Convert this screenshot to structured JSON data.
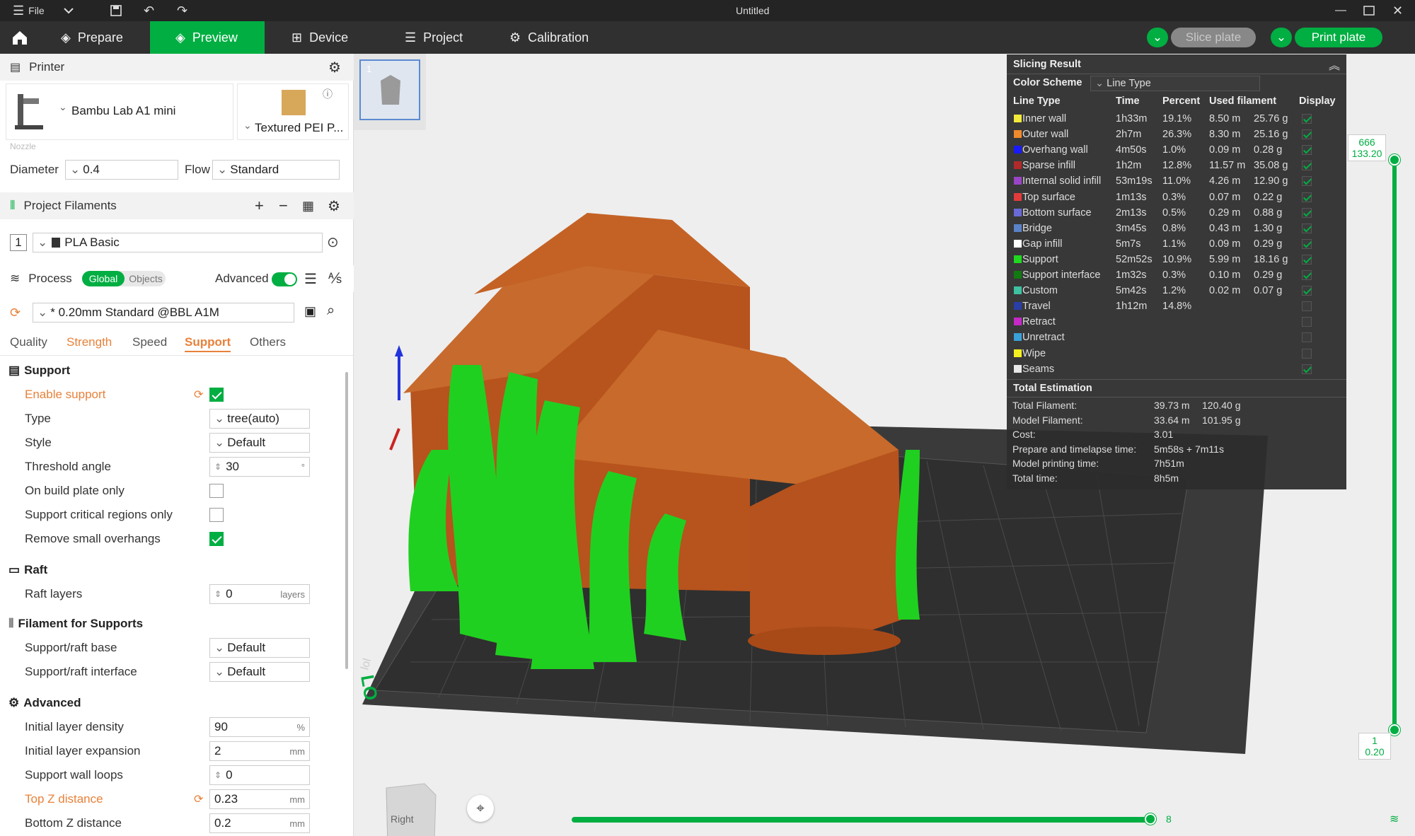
{
  "titlebar": {
    "file": "File",
    "title": "Untitled"
  },
  "menubar": {
    "tabs": [
      "Prepare",
      "Preview",
      "Device",
      "Project",
      "Calibration"
    ],
    "slice_plate": "Slice plate",
    "print_plate": "Print plate"
  },
  "printer": {
    "section": "Printer",
    "model": "Bambu Lab A1 mini",
    "plate": "Textured PEI P...",
    "nozzle_label": "Nozzle",
    "diameter_label": "Diameter",
    "diameter": "0.4",
    "flow_label": "Flow",
    "flow": "Standard"
  },
  "filaments": {
    "section": "Project Filaments",
    "index": "1",
    "name": "PLA Basic"
  },
  "process": {
    "section": "Process",
    "global": "Global",
    "objects": "Objects",
    "advanced": "Advanced",
    "preset": "* 0.20mm Standard @BBL A1M",
    "tabs": [
      "Quality",
      "Strength",
      "Speed",
      "Support",
      "Others"
    ]
  },
  "support": {
    "title": "Support",
    "enable_label": "Enable support",
    "type_label": "Type",
    "type": "tree(auto)",
    "style_label": "Style",
    "style": "Default",
    "threshold_label": "Threshold angle",
    "threshold": "30",
    "threshold_unit": "°",
    "build_plate_label": "On build plate only",
    "critical_label": "Support critical regions only",
    "small_overhangs_label": "Remove small overhangs"
  },
  "raft": {
    "title": "Raft",
    "layers_label": "Raft layers",
    "layers": "0",
    "layers_unit": "layers"
  },
  "filament_supports": {
    "title": "Filament for Supports",
    "base_label": "Support/raft base",
    "base": "Default",
    "interface_label": "Support/raft interface",
    "interface": "Default"
  },
  "advanced": {
    "title": "Advanced",
    "density_label": "Initial layer density",
    "density": "90",
    "density_unit": "%",
    "expansion_label": "Initial layer expansion",
    "expansion": "2",
    "expansion_unit": "mm",
    "wall_loops_label": "Support wall loops",
    "wall_loops": "0",
    "top_z_label": "Top Z distance",
    "top_z": "0.23",
    "top_z_unit": "mm",
    "bottom_z_label": "Bottom Z distance",
    "bottom_z": "0.2",
    "bottom_z_unit": "mm"
  },
  "plate_thumb": {
    "number": "1"
  },
  "view_cube": {
    "label": "Right"
  },
  "slicing_result": {
    "title": "Slicing Result",
    "color_scheme_label": "Color Scheme",
    "color_scheme": "Line Type",
    "headers": [
      "Line Type",
      "Time",
      "Percent",
      "Used filament",
      "Display"
    ],
    "rows": [
      {
        "name": "Inner wall",
        "color": "#f2e93a",
        "time": "1h33m",
        "percent": "19.1%",
        "length": "8.50 m",
        "weight": "25.76 g",
        "display": true
      },
      {
        "name": "Outer wall",
        "color": "#f08a2c",
        "time": "2h7m",
        "percent": "26.3%",
        "length": "8.30 m",
        "weight": "25.16 g",
        "display": true
      },
      {
        "name": "Overhang wall",
        "color": "#1a1aff",
        "time": "4m50s",
        "percent": "1.0%",
        "length": "0.09 m",
        "weight": "0.28 g",
        "display": true
      },
      {
        "name": "Sparse infill",
        "color": "#b02a2a",
        "time": "1h2m",
        "percent": "12.8%",
        "length": "11.57 m",
        "weight": "35.08 g",
        "display": true
      },
      {
        "name": "Internal solid infill",
        "color": "#9a44c8",
        "time": "53m19s",
        "percent": "11.0%",
        "length": "4.26 m",
        "weight": "12.90 g",
        "display": true
      },
      {
        "name": "Top surface",
        "color": "#e33b3b",
        "time": "1m13s",
        "percent": "0.3%",
        "length": "0.07 m",
        "weight": "0.22 g",
        "display": true
      },
      {
        "name": "Bottom surface",
        "color": "#6a6ad8",
        "time": "2m13s",
        "percent": "0.5%",
        "length": "0.29 m",
        "weight": "0.88 g",
        "display": true
      },
      {
        "name": "Bridge",
        "color": "#5a82c8",
        "time": "3m45s",
        "percent": "0.8%",
        "length": "0.43 m",
        "weight": "1.30 g",
        "display": true
      },
      {
        "name": "Gap infill",
        "color": "#ffffff",
        "time": "5m7s",
        "percent": "1.1%",
        "length": "0.09 m",
        "weight": "0.29 g",
        "display": true
      },
      {
        "name": "Support",
        "color": "#1fd81f",
        "time": "52m52s",
        "percent": "10.9%",
        "length": "5.99 m",
        "weight": "18.16 g",
        "display": true
      },
      {
        "name": "Support interface",
        "color": "#127a12",
        "time": "1m32s",
        "percent": "0.3%",
        "length": "0.10 m",
        "weight": "0.29 g",
        "display": true
      },
      {
        "name": "Custom",
        "color": "#3ec1a0",
        "time": "5m42s",
        "percent": "1.2%",
        "length": "0.02 m",
        "weight": "0.07 g",
        "display": true
      },
      {
        "name": "Travel",
        "color": "#2a3ea8",
        "time": "1h12m",
        "percent": "14.8%",
        "length": "",
        "weight": "",
        "display": false
      },
      {
        "name": "Retract",
        "color": "#c828c8",
        "time": "",
        "percent": "",
        "length": "",
        "weight": "",
        "display": false
      },
      {
        "name": "Unretract",
        "color": "#3aa0d8",
        "time": "",
        "percent": "",
        "length": "",
        "weight": "",
        "display": false
      },
      {
        "name": "Wipe",
        "color": "#f4f020",
        "time": "",
        "percent": "",
        "length": "",
        "weight": "",
        "display": false
      },
      {
        "name": "Seams",
        "color": "#e8e8e8",
        "time": "",
        "percent": "",
        "length": "",
        "weight": "",
        "display": true
      }
    ],
    "total_title": "Total Estimation",
    "totals": [
      {
        "label": "Total Filament:",
        "v1": "39.73 m",
        "v2": "120.40 g"
      },
      {
        "label": "Model Filament:",
        "v1": "33.64 m",
        "v2": "101.95 g"
      },
      {
        "label": "Cost:",
        "v1": "3.01",
        "v2": ""
      },
      {
        "label": "Prepare and timelapse time:",
        "v1": "5m58s + 7m11s",
        "v2": ""
      },
      {
        "label": "Model printing time:",
        "v1": "7h51m",
        "v2": ""
      },
      {
        "label": "Total time:",
        "v1": "8h5m",
        "v2": ""
      }
    ]
  },
  "layer_slider": {
    "top_layer": "666",
    "top_height": "133.20",
    "bottom_layer": "1",
    "bottom_height": "0.20"
  },
  "move_slider": {
    "value": "8"
  }
}
